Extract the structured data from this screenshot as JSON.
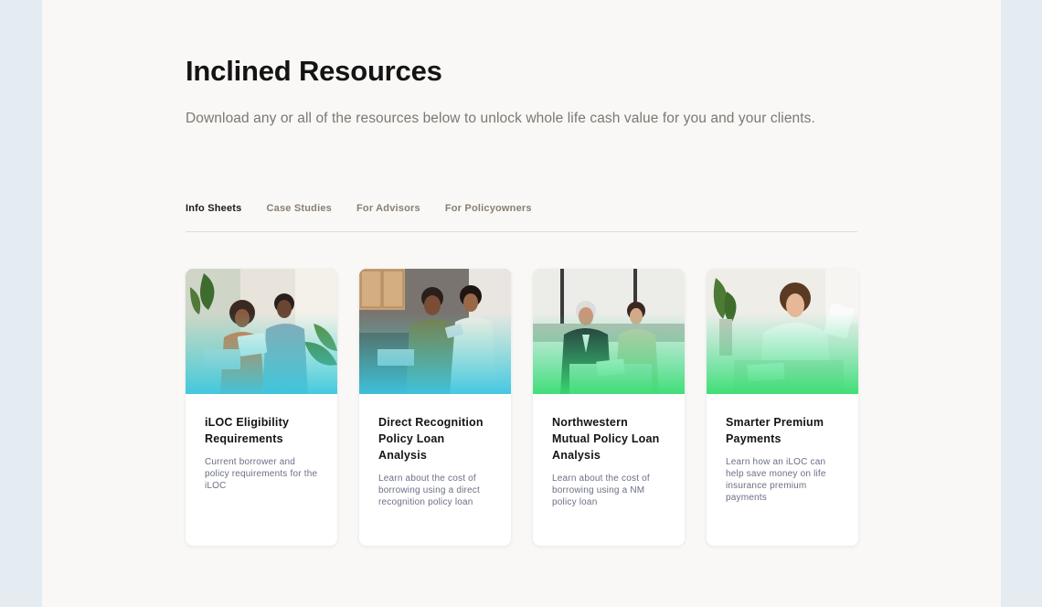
{
  "header": {
    "title": "Inclined Resources",
    "subtitle": "Download any or all of the resources below to unlock whole life cash value for you and your clients."
  },
  "tabs": [
    {
      "label": "Info Sheets",
      "active": true
    },
    {
      "label": "Case Studies",
      "active": false
    },
    {
      "label": "For Advisors",
      "active": false
    },
    {
      "label": "For Policyowners",
      "active": false
    }
  ],
  "cards": [
    {
      "title": "iLOC Eligibility Requirements",
      "description": "Current borrower and policy requirements for the iLOC",
      "image": "photo-couple-with-laptop"
    },
    {
      "title": "Direct Recognition Policy Loan Analysis",
      "description": "Learn about the cost of borrowing using a direct recognition policy loan",
      "image": "photo-couple-reviewing-tablet"
    },
    {
      "title": "Northwestern Mutual Policy Loan Analysis",
      "description": "Learn about the cost of borrowing using a NM policy loan",
      "image": "photo-advisor-meeting"
    },
    {
      "title": "Smarter Premium Payments",
      "description": "Learn how an iLOC can help save money on life insurance premium payments",
      "image": "photo-woman-paying-bills"
    }
  ],
  "colors": {
    "page_background": "#f9f8f6",
    "outer_background": "#e4ebf1",
    "gradient_teal": "#3ed8c8",
    "gradient_green": "#3ee07a"
  }
}
